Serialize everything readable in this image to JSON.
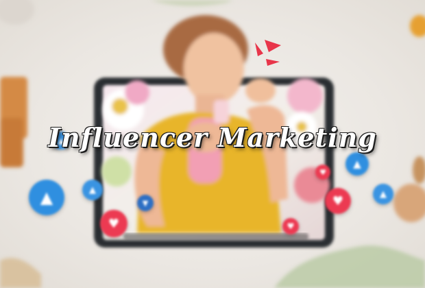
{
  "image": {
    "headline": "Influencer Marketing",
    "icons": [
      "like-thumb-icon",
      "heart-icon",
      "wifi-icon"
    ],
    "colors": {
      "background": "#ece8e3",
      "tablet_frame": "#2a2d33",
      "shirt": "#e8b52a",
      "bottle": "#f29fb4",
      "like_blue": "#2f8fe0",
      "heart_red": "#ec3a52",
      "accent_red": "#e8354a"
    }
  }
}
